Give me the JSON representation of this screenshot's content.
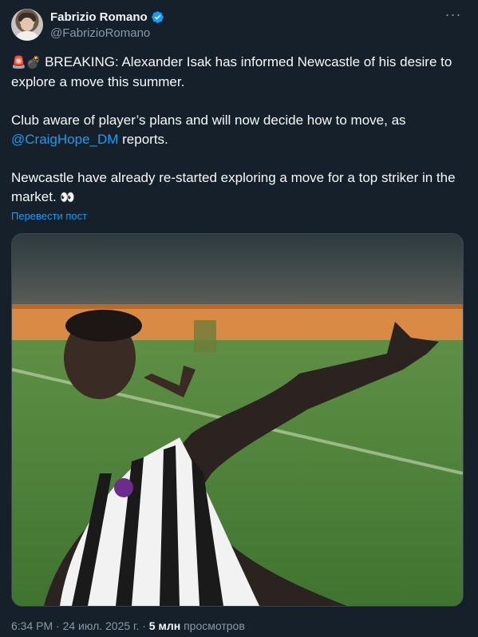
{
  "author": {
    "display_name": "Fabrizio Romano",
    "handle": "@FabrizioRomano",
    "verified": true
  },
  "tweet": {
    "emoji_prefix": "🚨💣",
    "para1": "BREAKING: Alexander Isak has informed Newcastle of his desire to explore a move this summer.",
    "para2_before": "Club aware of player’s plans and will now decide how to move, as ",
    "para2_mention": "@CraigHope_DM",
    "para2_after": " reports.",
    "para3": "Newcastle have already re-started exploring a move for a top striker in the market. ",
    "para3_emoji": "👀"
  },
  "translate_label": "Перевести пост",
  "footer": {
    "time": "6:34 PM",
    "sep1": " · ",
    "date": "24 июл. 2025 г.",
    "sep2": " · ",
    "views_count": "5 млн",
    "views_label": " просмотров"
  },
  "colors": {
    "background": "#15202b",
    "accent": "#1d9bf0",
    "muted": "#8b98a5"
  }
}
